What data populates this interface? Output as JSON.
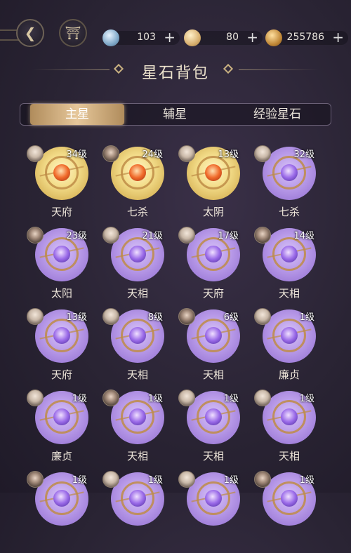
{
  "header": {
    "back_icon": "back-arrow-icon",
    "home_icon": "pavilion-home-icon",
    "resources": [
      {
        "icon": "water-drop-gem-icon",
        "value": "103",
        "plus": "+"
      },
      {
        "icon": "money-bag-icon",
        "value": "80",
        "plus": "+"
      },
      {
        "icon": "coin-icon",
        "value": "255786",
        "plus": "+"
      }
    ]
  },
  "page_title": "星石背包",
  "tabs": [
    {
      "label": "主星",
      "active": true
    },
    {
      "label": "辅星",
      "active": false
    },
    {
      "label": "经验星石",
      "active": false
    }
  ],
  "colors": {
    "gold_disc": "#f3dd8a",
    "purple_disc": "#b89ae8",
    "tab_active": "#e6c79a"
  },
  "items": [
    {
      "level": "34级",
      "name": "天府",
      "tier": "gold"
    },
    {
      "level": "24级",
      "name": "七杀",
      "tier": "gold"
    },
    {
      "level": "13级",
      "name": "太阴",
      "tier": "gold"
    },
    {
      "level": "32级",
      "name": "七杀",
      "tier": "purple"
    },
    {
      "level": "23级",
      "name": "太阳",
      "tier": "purple"
    },
    {
      "level": "21级",
      "name": "天相",
      "tier": "purple"
    },
    {
      "level": "17级",
      "name": "天府",
      "tier": "purple"
    },
    {
      "level": "14级",
      "name": "天相",
      "tier": "purple"
    },
    {
      "level": "13级",
      "name": "天府",
      "tier": "purple"
    },
    {
      "level": "8级",
      "name": "天相",
      "tier": "purple"
    },
    {
      "level": "6级",
      "name": "天相",
      "tier": "purple"
    },
    {
      "level": "1级",
      "name": "廉贞",
      "tier": "purple"
    },
    {
      "level": "1级",
      "name": "廉贞",
      "tier": "purple"
    },
    {
      "level": "1级",
      "name": "天相",
      "tier": "purple"
    },
    {
      "level": "1级",
      "name": "天相",
      "tier": "purple"
    },
    {
      "level": "1级",
      "name": "天相",
      "tier": "purple"
    },
    {
      "level": "1级",
      "name": "",
      "tier": "purple"
    },
    {
      "level": "1级",
      "name": "",
      "tier": "purple"
    },
    {
      "level": "1级",
      "name": "",
      "tier": "purple"
    },
    {
      "level": "1级",
      "name": "",
      "tier": "purple"
    }
  ]
}
